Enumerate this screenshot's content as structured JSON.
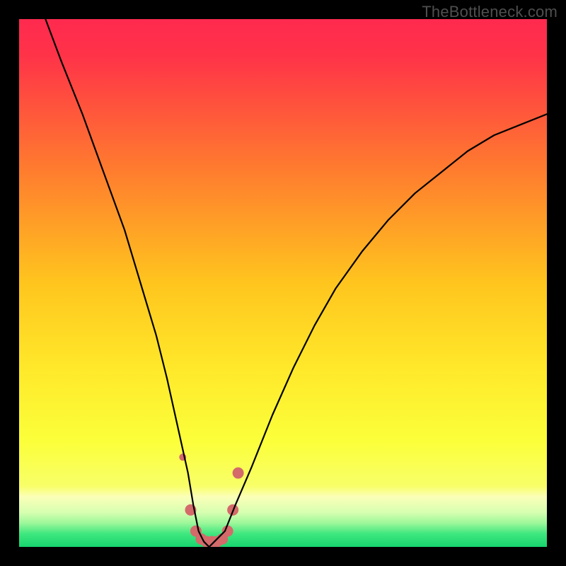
{
  "watermark": "TheBottleneck.com",
  "colors": {
    "bg": "#000000",
    "grad_top": "#ff2a4f",
    "grad_mid_upper": "#ff8a2a",
    "grad_mid": "#ffe62a",
    "grad_lower": "#f8ff6a",
    "grad_pale": "#e8ffb0",
    "grad_green": "#1ee678",
    "curve": "#000000",
    "marker_fill": "#d46a6a",
    "marker_stroke": "#c65555"
  },
  "chart_data": {
    "type": "line",
    "title": "",
    "xlabel": "",
    "ylabel": "",
    "xlim": [
      0,
      100
    ],
    "ylim": [
      0,
      100
    ],
    "grid": false,
    "legend": false,
    "annotations": [
      "TheBottleneck.com"
    ],
    "series": [
      {
        "name": "bottleneck-curve",
        "x": [
          5,
          8,
          12,
          16,
          20,
          23,
          26,
          28,
          30,
          32,
          33,
          34,
          35,
          36,
          37,
          39,
          41,
          44,
          48,
          52,
          56,
          60,
          65,
          70,
          75,
          80,
          85,
          90,
          95,
          100
        ],
        "y": [
          100,
          92,
          82,
          71,
          60,
          50,
          40,
          32,
          23,
          14,
          8,
          3,
          1,
          0,
          1,
          3,
          8,
          15,
          25,
          34,
          42,
          49,
          56,
          62,
          67,
          71,
          75,
          78,
          80,
          82
        ]
      }
    ],
    "markers": {
      "name": "bottom-highlight",
      "x": [
        31.0,
        32.5,
        33.5,
        34.5,
        35.5,
        36.5,
        37.5,
        38.5,
        39.5,
        40.5,
        41.5
      ],
      "y": [
        17,
        7,
        3,
        1.5,
        1,
        1,
        1,
        1.5,
        3,
        7,
        14
      ],
      "radius": [
        5,
        8,
        8,
        8,
        8,
        8,
        8,
        8,
        8,
        8,
        8
      ]
    }
  }
}
